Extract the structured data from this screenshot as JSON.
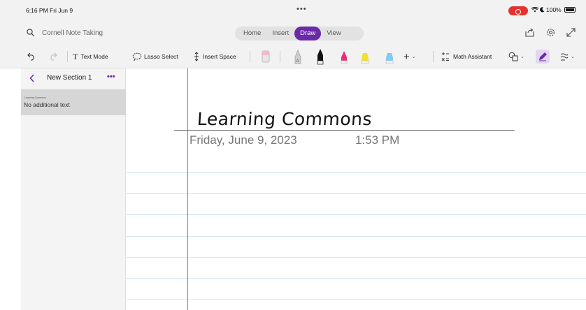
{
  "status_bar": {
    "time": "6:16 PM  Fri Jun 9",
    "dots": "•••",
    "battery": "100%"
  },
  "header": {
    "notebook_title": "Cornell Note Taking",
    "tabs": [
      {
        "label": "Home"
      },
      {
        "label": "Insert"
      },
      {
        "label": "Draw"
      },
      {
        "label": "View"
      }
    ],
    "active_tab": "Draw"
  },
  "toolbar": {
    "text_mode": "Text Mode",
    "lasso_select": "Lasso Select",
    "insert_space": "Insert Space",
    "math_assistant": "Math Assistant",
    "pen_colors": [
      "#cccccc",
      "#111111",
      "#e8307a",
      "#f2e22b",
      "#7ecdf0"
    ],
    "accent": "#6b2aa8"
  },
  "sidebar": {
    "section_title": "New Section 1",
    "more": "•••",
    "pages": [
      {
        "title": "Learning Commons",
        "subtitle": "No additional text"
      }
    ]
  },
  "page": {
    "title": "Learning Commons",
    "date": "Friday, June 9, 2023",
    "time": "1:53 PM"
  }
}
